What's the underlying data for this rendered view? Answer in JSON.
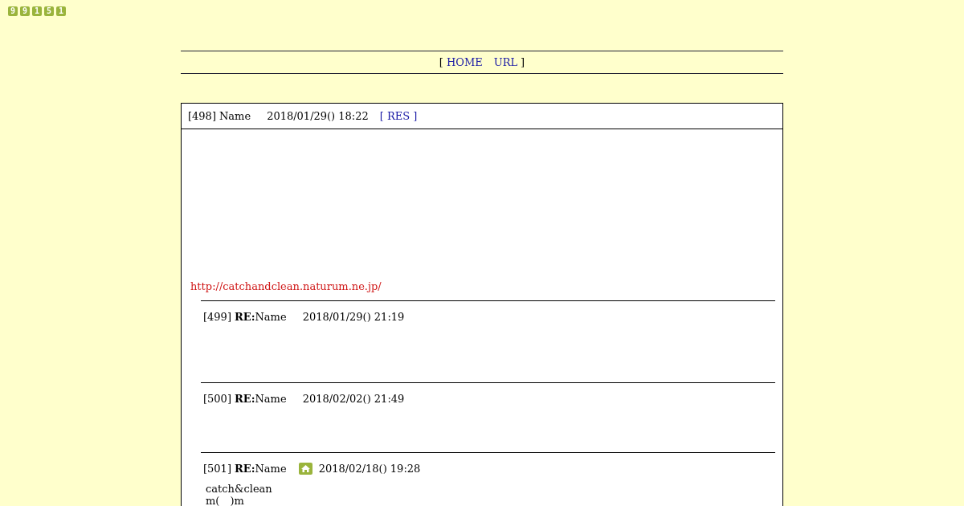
{
  "counter": [
    "9",
    "9",
    "1",
    "5",
    "1"
  ],
  "nav": {
    "open": "[",
    "links": [
      "HOME",
      "URL"
    ],
    "close": "]"
  },
  "post": {
    "number": "[498]",
    "name": "Name",
    "date": "2018/01/29() 18:22",
    "res": "[ RES ]",
    "url": "http://catchandclean.naturum.ne.jp/",
    "replies": [
      {
        "number": "[499]",
        "re": "RE:",
        "name": "Name",
        "home_icon": false,
        "date": "2018/01/29() 21:19"
      },
      {
        "number": "[500]",
        "re": "RE:",
        "name": "Name",
        "home_icon": false,
        "date": "2018/02/02() 21:49"
      },
      {
        "number": "[501]",
        "re": "RE:",
        "name": "Name",
        "home_icon": true,
        "date": "2018/02/18() 19:28",
        "lines": [
          "catch&clean",
          "m(　)m"
        ]
      }
    ]
  }
}
